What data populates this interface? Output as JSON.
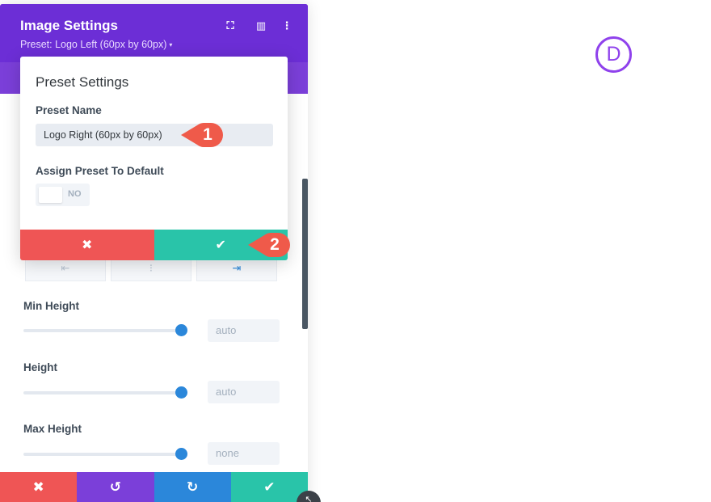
{
  "panel": {
    "title": "Image Settings",
    "preset": "Preset: Logo Left (60px by 60px)",
    "caret_glyph": "▾",
    "header_icons": {
      "focus_glyph": "⛶",
      "layout_glyph": "▥",
      "menu_glyph": "⋮"
    },
    "align_glyphs": [
      "⇤",
      "⁝",
      "⇥"
    ],
    "fields": [
      {
        "label": "Min Height",
        "value": "auto",
        "level": 1.0
      },
      {
        "label": "Height",
        "value": "auto",
        "level": 1.0
      },
      {
        "label": "Max Height",
        "value": "none",
        "level": 1.0
      }
    ],
    "footer": {
      "cancel_glyph": "✖",
      "undo_glyph": "↺",
      "redo_glyph": "↻",
      "save_glyph": "✔"
    }
  },
  "popup": {
    "title": "Preset Settings",
    "name_label": "Preset Name",
    "name_value": "Logo Right (60px by 60px)",
    "default_label": "Assign Preset To Default",
    "toggle_text": "NO",
    "cancel_glyph": "✖",
    "confirm_glyph": "✔"
  },
  "callouts": [
    "1",
    "2"
  ],
  "logo_letter": "D",
  "resize_glyph": "↖",
  "colors": {
    "purple": "#6c2ed6",
    "purple_light": "#7b3fd9",
    "red": "#ef5555",
    "teal": "#29c4a9",
    "blue": "#2b87da",
    "violet": "#8f42ec",
    "callout": "#ef5a4a"
  }
}
